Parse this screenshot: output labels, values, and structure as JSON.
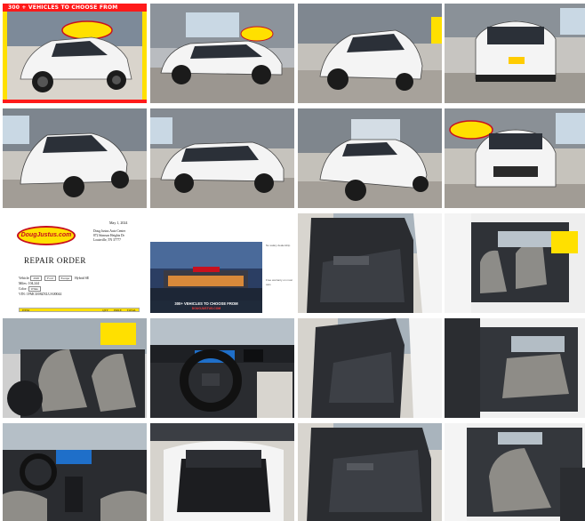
{
  "gallery": {
    "banner_text": "300 + VEHICLES TO CHOOSE FROM",
    "tiles": [
      {
        "name": "photo-front-three-quarter-promo",
        "alt": "white SUV front view with promotional border"
      },
      {
        "name": "photo-side-left",
        "alt": "white SUV left side"
      },
      {
        "name": "photo-rear-three-quarter-left",
        "alt": "white SUV rear three-quarter"
      },
      {
        "name": "photo-rear",
        "alt": "white SUV rear"
      },
      {
        "name": "photo-rear-three-quarter-right",
        "alt": "white SUV rear three-quarter"
      },
      {
        "name": "photo-side-right",
        "alt": "white SUV right side"
      },
      {
        "name": "photo-front-three-quarter-right",
        "alt": "white SUV front three-quarter"
      },
      {
        "name": "photo-front",
        "alt": "white SUV front"
      },
      {
        "name": "repair-order-document"
      },
      {
        "name": "dealership-promo"
      },
      {
        "name": "photo-driver-door-interior"
      },
      {
        "name": "photo-front-seats-passenger-view"
      },
      {
        "name": "photo-front-seats-driver-view"
      },
      {
        "name": "photo-dashboard-steering"
      },
      {
        "name": "photo-rear-door-interior"
      },
      {
        "name": "photo-rear-seats"
      },
      {
        "name": "photo-dash-center-console"
      },
      {
        "name": "photo-cargo-area"
      },
      {
        "name": "photo-rear-door-panel"
      },
      {
        "name": "photo-rear-seats-right"
      }
    ]
  },
  "repair_order": {
    "logo_text": "DougJustus.com",
    "date": "May 1, 2024",
    "address_lines": [
      "Doug Justus Auto Center",
      "872 Stimson Heights Dr",
      "Louisville, TN 37777"
    ],
    "title": "REPAIR ORDER",
    "vehicle_label": "Vehicle:",
    "vehicle_year": "2020",
    "vehicle_make": "Ford",
    "vehicle_model": "Escape",
    "vehicle_trim": "Hybrid SE",
    "miles_label": "Miles:",
    "miles_value": "104,244",
    "color_label": "Color:",
    "color_value": "White",
    "vin_label": "VIN:",
    "vin_value": "1FMCU0BZXLUA00044",
    "col_item": "ITEM",
    "col_qty": "QTY",
    "col_price": "PRICE",
    "col_total": "TOTAL"
  },
  "promo": {
    "headline": "300+ VEHICLES TO CHOOSE FROM",
    "subline": "DOUGJUSTUS.COM",
    "side_text_1": "No salary dealership",
    "side_text_2": "Free warranty on most cars"
  },
  "colors": {
    "banner_red": "#ff1a1a",
    "logo_yellow": "#ffe000",
    "logo_red": "#c8101e",
    "car_white": "#f4f4f4"
  }
}
